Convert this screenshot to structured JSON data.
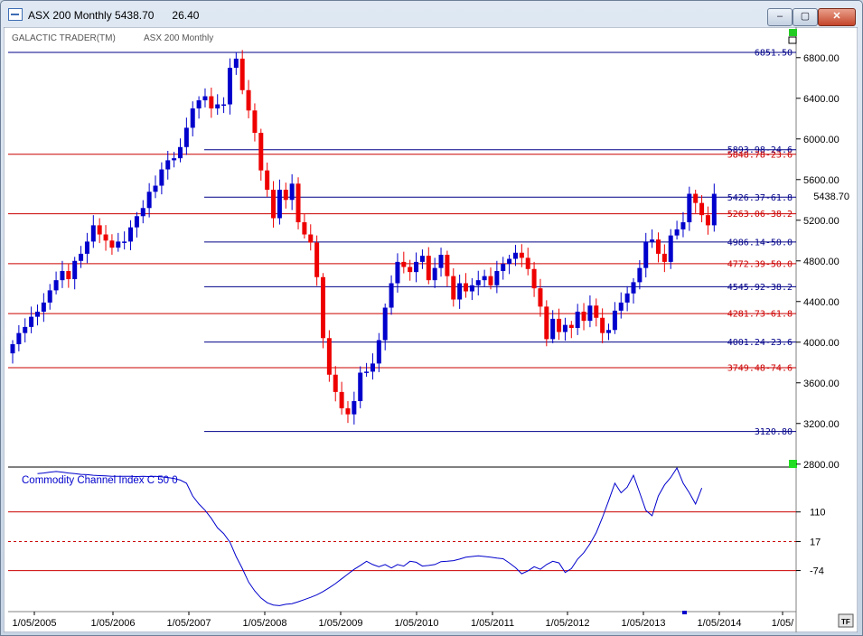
{
  "window": {
    "title": "ASX 200 Monthly 5438.70      26.40",
    "minimize_label": "–",
    "maximize_label": "▢",
    "close_label": "✕"
  },
  "chart": {
    "header_left": "GALACTIC TRADER(TM)",
    "header_right": "ASX 200 Monthly",
    "last_price_label": "5438.70",
    "corner_button_label": "TF",
    "price_ticks": [
      6800,
      6400,
      6000,
      5600,
      5200,
      4800,
      4400,
      4000,
      3600,
      3200,
      2800
    ],
    "price_tick_labels": [
      "6800.00",
      "6400.00",
      "6000.00",
      "5600.00",
      "5200.00",
      "4800.00",
      "4400.00",
      "4000.00",
      "3600.00",
      "3200.00",
      "2800.00"
    ],
    "x_labels": [
      "1/05/2005",
      "1/05/2006",
      "1/05/2007",
      "1/05/2008",
      "1/05/2009",
      "1/05/2010",
      "1/05/2011",
      "1/05/2012",
      "1/05/2013",
      "1/05/2014",
      "1/05/"
    ],
    "colors": {
      "up": "#0000cc",
      "down": "#ee0000",
      "blue_level": "#000088",
      "red_level": "#cc0000",
      "cci": "#0000cc",
      "background": "#ffffff"
    },
    "levels": [
      {
        "value": 6851.5,
        "label": "6851.50",
        "color": "blue",
        "scope": "full"
      },
      {
        "value": 5893.98,
        "label": "5893.98-24.6",
        "color": "blue",
        "scope": "partial"
      },
      {
        "value": 5848.78,
        "label": "5848.78-23.6",
        "color": "red",
        "scope": "full"
      },
      {
        "value": 5426.37,
        "label": "5426.37-61.8",
        "color": "blue",
        "scope": "partial"
      },
      {
        "value": 5263.06,
        "label": "5263.06-38.2",
        "color": "red",
        "scope": "full"
      },
      {
        "value": 4986.14,
        "label": "4986.14-50.0",
        "color": "blue",
        "scope": "partial"
      },
      {
        "value": 4772.39,
        "label": "4772.39-50.0",
        "color": "red",
        "scope": "full"
      },
      {
        "value": 4545.92,
        "label": "4545.92-38.2",
        "color": "blue",
        "scope": "partial"
      },
      {
        "value": 4281.73,
        "label": "4281.73-61.8",
        "color": "red",
        "scope": "full"
      },
      {
        "value": 4001.24,
        "label": "4001.24-23.6",
        "color": "blue",
        "scope": "partial"
      },
      {
        "value": 3749.48,
        "label": "3749.48-74.6",
        "color": "red",
        "scope": "full"
      },
      {
        "value": 3120.8,
        "label": "3120.80",
        "color": "blue",
        "scope": "partial"
      }
    ]
  },
  "cci": {
    "title": "Commodity Channel Index C 50 0",
    "ticks": [
      110,
      17,
      -74
    ],
    "tick_labels": [
      "110",
      "17",
      "-74"
    ]
  },
  "chart_data": {
    "type": "candlestick",
    "title": "ASX 200 Monthly",
    "ylim": [
      2780,
      6920
    ],
    "x_ticks": [
      "1/05/2005",
      "1/05/2006",
      "1/05/2007",
      "1/05/2008",
      "1/05/2009",
      "1/05/2010",
      "1/05/2011",
      "1/05/2012",
      "1/05/2013",
      "1/05/2014",
      "1/05/"
    ],
    "closes": [
      3980,
      4090,
      4150,
      4250,
      4300,
      4390,
      4510,
      4610,
      4700,
      4620,
      4800,
      4870,
      4990,
      5150,
      5060,
      5000,
      4930,
      4990,
      4990,
      5130,
      5240,
      5320,
      5480,
      5540,
      5700,
      5790,
      5810,
      5920,
      6110,
      6300,
      6380,
      6420,
      6300,
      6340,
      6340,
      6700,
      6790,
      6480,
      6280,
      6060,
      5690,
      5500,
      5220,
      5500,
      5400,
      5560,
      5180,
      5060,
      4980,
      4640,
      4040,
      3680,
      3510,
      3350,
      3290,
      3420,
      3700,
      3710,
      3790,
      4020,
      4340,
      4580,
      4790,
      4740,
      4690,
      4790,
      4850,
      4610,
      4730,
      4860,
      4650,
      4420,
      4580,
      4500,
      4560,
      4610,
      4650,
      4560,
      4700,
      4770,
      4820,
      4880,
      4830,
      4720,
      4530,
      4350,
      4030,
      4230,
      4100,
      4170,
      4140,
      4300,
      4210,
      4360,
      4240,
      4090,
      4120,
      4310,
      4390,
      4480,
      4590,
      4730,
      4990,
      5010,
      4870,
      4790,
      5050,
      5110,
      5180,
      5460,
      5370,
      5250,
      5150,
      5460
    ],
    "cci": {
      "name": "Commodity Channel Index C 50 0",
      "values": [
        230,
        232,
        235,
        237,
        235,
        232,
        230,
        228,
        227,
        225,
        224,
        223,
        222,
        222,
        222,
        222,
        221,
        222,
        221,
        222,
        220,
        218,
        215,
        210,
        200,
        160,
        135,
        115,
        90,
        60,
        42,
        15,
        -30,
        -68,
        -110,
        -138,
        -160,
        -175,
        -182,
        -184,
        -180,
        -178,
        -172,
        -165,
        -158,
        -150,
        -140,
        -128,
        -115,
        -100,
        -85,
        -70,
        -58,
        -45,
        -55,
        -62,
        -55,
        -66,
        -55,
        -60,
        -45,
        -48,
        -60,
        -58,
        -55,
        -46,
        -45,
        -43,
        -38,
        -32,
        -30,
        -28,
        -30,
        -32,
        -35,
        -37,
        -50,
        -65,
        -84,
        -75,
        -62,
        -70,
        -55,
        -45,
        -50,
        -80,
        -68,
        -38,
        -18,
        10,
        45,
        92,
        145,
        200,
        170,
        188,
        225,
        170,
        115,
        98,
        160,
        195,
        218,
        248,
        200,
        170,
        135,
        185
      ]
    }
  }
}
